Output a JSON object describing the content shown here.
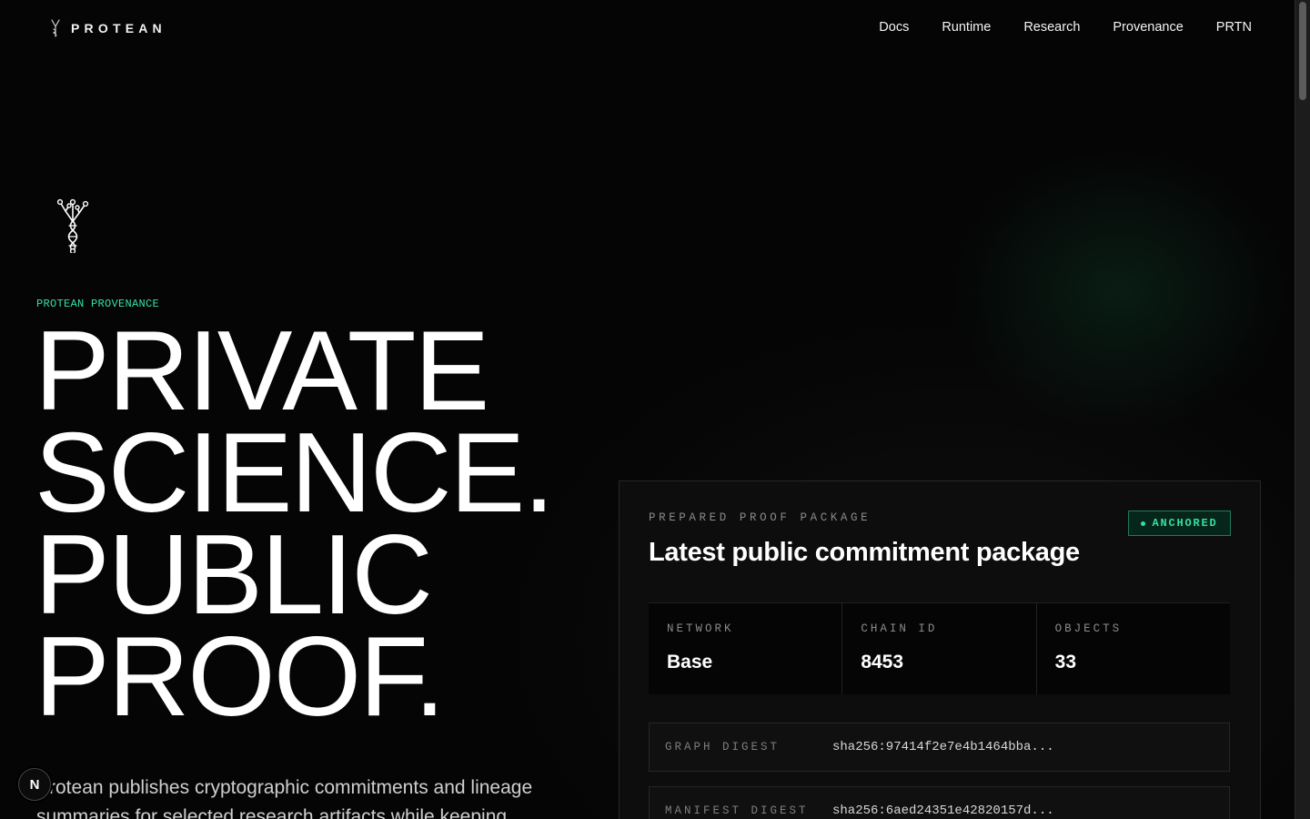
{
  "header": {
    "brand": "PROTEAN",
    "nav": [
      "Docs",
      "Runtime",
      "Research",
      "Provenance",
      "PRTN"
    ]
  },
  "hero": {
    "eyebrow": "PROTEAN PROVENANCE",
    "headline": [
      "PRIVATE",
      "SCIENCE.",
      "PUBLIC",
      "PROOF."
    ],
    "lede": "Protean publishes cryptographic commitments and lineage summaries for selected research artifacts while keeping"
  },
  "card": {
    "kicker": "PREPARED PROOF PACKAGE",
    "title": "Latest public commitment package",
    "status": "ANCHORED",
    "stats": [
      {
        "label": "NETWORK",
        "value": "Base"
      },
      {
        "label": "CHAIN ID",
        "value": "8453"
      },
      {
        "label": "OBJECTS",
        "value": "33"
      }
    ],
    "digests": [
      {
        "label": "GRAPH DIGEST",
        "value": "sha256:97414f2e7e4b1464bba..."
      },
      {
        "label": "MANIFEST DIGEST",
        "value": "sha256:6aed24351e42820157d..."
      }
    ]
  },
  "dev_badge": "N",
  "colors": {
    "background": "#050505",
    "accent": "#34e0a1",
    "card": "#0d0d0d"
  },
  "icons": [
    "protean-dna-logo-icon",
    "nextjs-badge-icon"
  ]
}
